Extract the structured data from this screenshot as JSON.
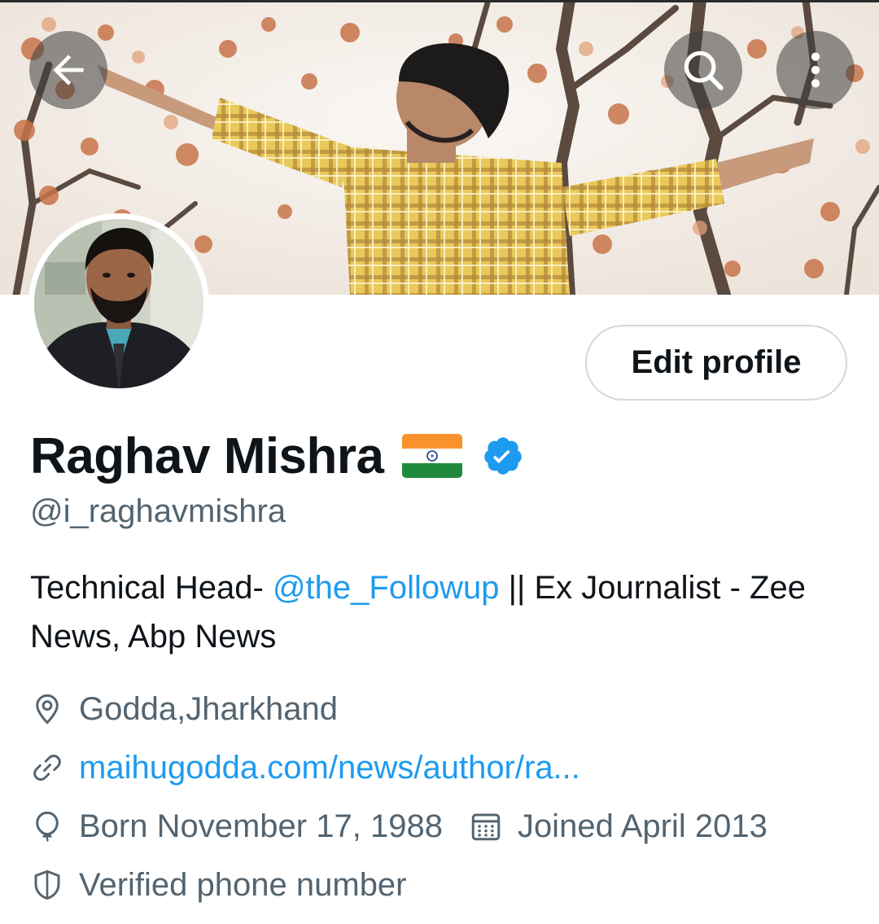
{
  "header": {
    "back_icon": "arrow-left-icon",
    "search_icon": "search-icon",
    "more_icon": "more-vertical-icon"
  },
  "profile": {
    "name": "Raghav Mishra",
    "flag": "indian-flag-emoji",
    "verified_badge": "verified-badge-icon",
    "handle": "@i_raghavmishra",
    "edit_button_label": "Edit profile"
  },
  "bio": {
    "prefix": "Technical Head- ",
    "mention": "@the_Followup",
    "suffix": " || Ex Journalist - Zee News, Abp News"
  },
  "meta": {
    "location": "Godda,Jharkhand",
    "website": "maihugodda.com/news/author/ra...",
    "birthday": "Born November 17, 1988",
    "joined": "Joined April 2013",
    "verified_phone": "Verified phone number"
  },
  "colors": {
    "accent": "#1d9bf0",
    "secondary_text": "#536471",
    "primary_text": "#0f1419",
    "border": "#cfd9de"
  }
}
